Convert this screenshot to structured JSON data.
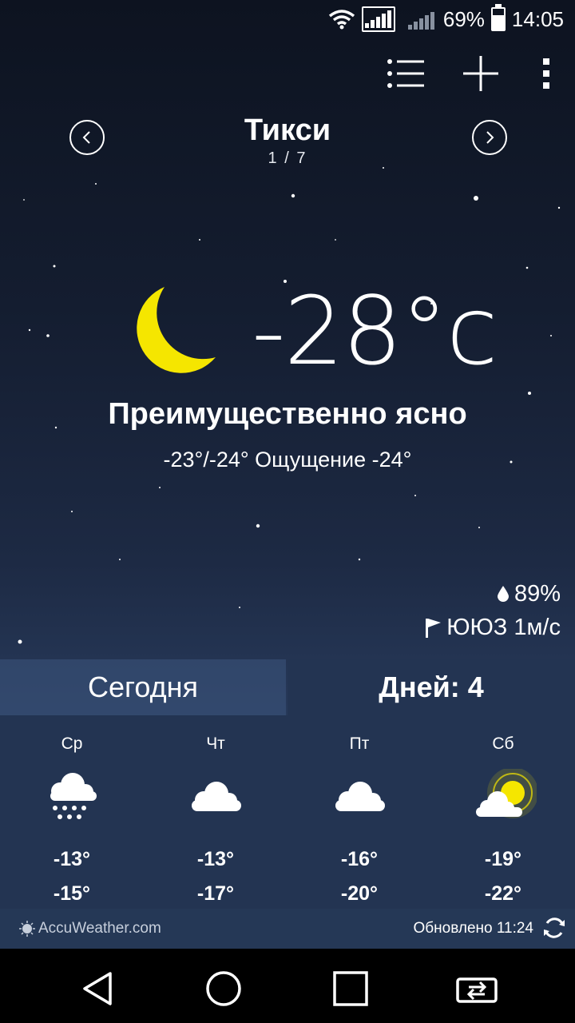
{
  "status": {
    "battery": "69%",
    "time": "14:05"
  },
  "location": {
    "name": "Тикси",
    "index": "1 / 7"
  },
  "current": {
    "temp": "-28°c",
    "condition": "Преимущественно ясно",
    "range": "-23°/-24° Ощущение -24°",
    "humidity": "89%",
    "wind": "ЮЮЗ 1м/с"
  },
  "tabs": {
    "today": "Сегодня",
    "days": "Дней: 4"
  },
  "forecast": [
    {
      "day": "Ср",
      "icon": "snow-cloud-icon",
      "hi": "-13°",
      "lo": "-15°"
    },
    {
      "day": "Чт",
      "icon": "cloud-icon",
      "hi": "-13°",
      "lo": "-17°"
    },
    {
      "day": "Пт",
      "icon": "cloud-icon",
      "hi": "-16°",
      "lo": "-20°"
    },
    {
      "day": "Сб",
      "icon": "partly-sunny-icon",
      "hi": "-19°",
      "lo": "-22°"
    }
  ],
  "footer": {
    "brand": "AccuWeather.com",
    "updated": "Обновлено 11:24"
  },
  "colors": {
    "moon": "#f5e600",
    "panel": "#233452"
  }
}
